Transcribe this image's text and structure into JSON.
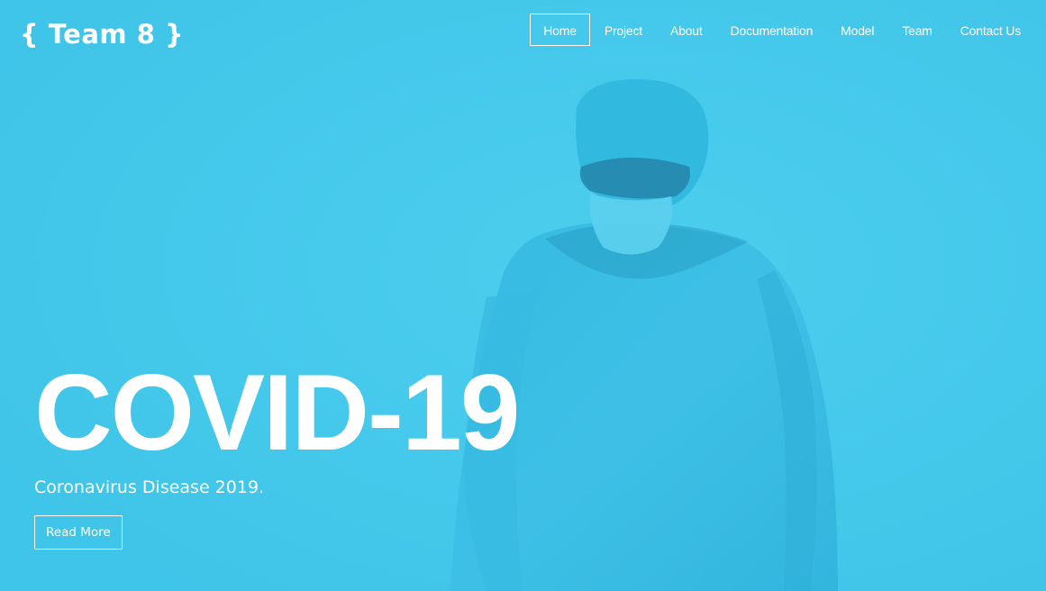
{
  "brand": {
    "logo_text": "{ Team 8 }"
  },
  "nav": {
    "items": [
      {
        "label": "Home",
        "active": true
      },
      {
        "label": "Project",
        "active": false
      },
      {
        "label": "About",
        "active": false
      },
      {
        "label": "Documentation",
        "active": false
      },
      {
        "label": "Model",
        "active": false
      },
      {
        "label": "Team",
        "active": false
      },
      {
        "label": "Contact Us",
        "active": false
      }
    ]
  },
  "hero": {
    "title": "COVID-19",
    "subtitle": "Coronavirus Disease 2019.",
    "cta_label": "Read More",
    "background_image": "doctor-in-protective-gear-photo"
  },
  "colors": {
    "overlay": "#43c9ea",
    "text": "#ffffff"
  }
}
